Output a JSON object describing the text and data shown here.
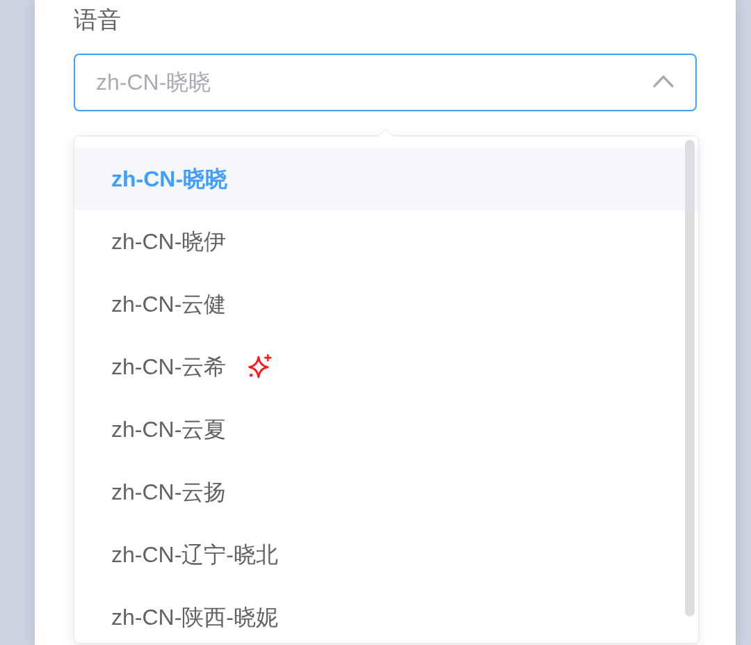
{
  "field": {
    "label": "语音",
    "placeholder": "zh-CN-晓晓",
    "expanded": true
  },
  "dropdown": {
    "options": [
      {
        "label": "zh-CN-晓晓",
        "selected": true,
        "kind": "plain"
      },
      {
        "label": "zh-CN-晓伊",
        "selected": false,
        "kind": "plain"
      },
      {
        "label": "zh-CN-云健",
        "selected": false,
        "kind": "plain"
      },
      {
        "label": "zh-CN-云希",
        "selected": false,
        "kind": "sparkle"
      },
      {
        "label": "zh-CN-云夏",
        "selected": false,
        "kind": "plain"
      },
      {
        "label": "zh-CN-云扬",
        "selected": false,
        "kind": "plain"
      },
      {
        "label": "zh-CN-辽宁-晓北",
        "selected": false,
        "kind": "plain"
      },
      {
        "label": "zh-CN-陕西-晓妮",
        "selected": false,
        "kind": "plain"
      }
    ]
  }
}
